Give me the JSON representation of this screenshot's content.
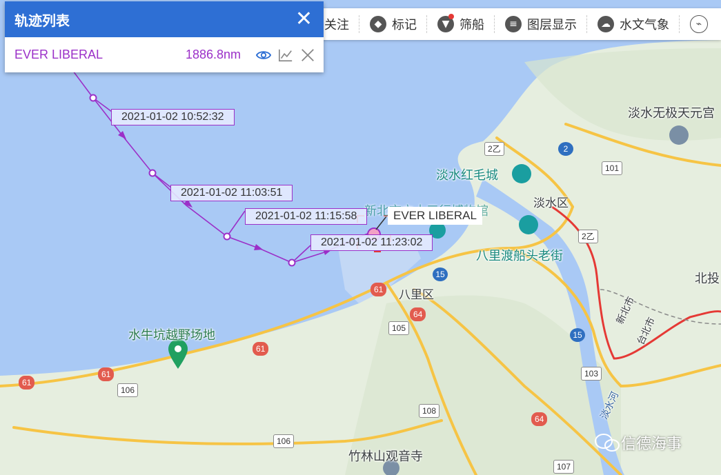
{
  "panel": {
    "title": "轨迹列表",
    "ship_name": "EVER LIBERAL",
    "distance": "1886.8nm"
  },
  "toolbar": {
    "items": [
      {
        "label": "关注",
        "icon": "star-icon"
      },
      {
        "label": "标记",
        "icon": "tag-icon"
      },
      {
        "label": "筛船",
        "icon": "filter-icon"
      },
      {
        "label": "图层显示",
        "icon": "layers-icon"
      },
      {
        "label": "水文气象",
        "icon": "weather-icon"
      }
    ]
  },
  "track": {
    "timestamps": [
      "2021-01-02 10:52:32",
      "2021-01-02 11:03:51",
      "2021-01-02 11:15:58",
      "2021-01-02 11:23:02"
    ],
    "ship_label": "EVER LIBERAL",
    "color": "#9b30c8"
  },
  "map": {
    "places": [
      "淡水无极天元宫",
      "淡水红毛城",
      "淡水区",
      "新北市立十三行博物馆",
      "八里渡船头老街",
      "八里区",
      "北投",
      "水牛坑越野场地",
      "竹林山观音寺",
      "新北市",
      "台北市",
      "淡水河"
    ],
    "roads": [
      "2乙",
      "2",
      "101",
      "2乙",
      "61",
      "15",
      "64",
      "105",
      "15",
      "61",
      "103",
      "61",
      "61",
      "106",
      "108",
      "64",
      "106",
      "107"
    ],
    "colors": {
      "sea": "#a9c9f5",
      "land": "#e7efe0",
      "river": "#a9c9f5",
      "road": "#f6c445"
    }
  },
  "watermark": "信德海事"
}
